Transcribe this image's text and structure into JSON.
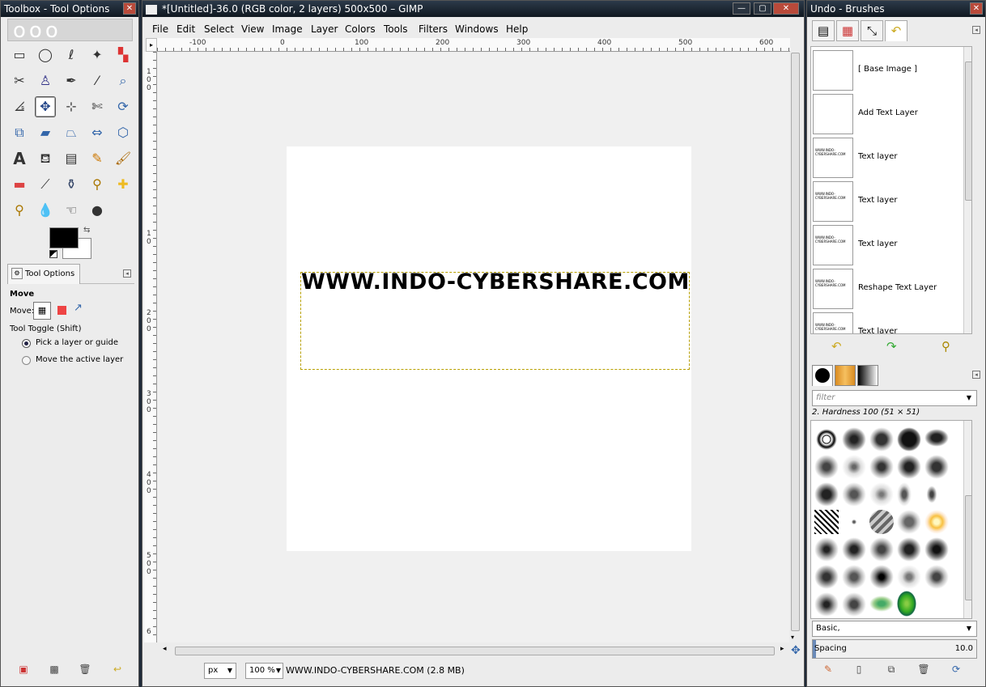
{
  "toolbox": {
    "title": "Toolbox - Tool Options",
    "fg_color": "#000000",
    "bg_color": "#ffffff",
    "tool_options_tab": "Tool Options",
    "tool_name": "Move",
    "move_label": "Move:",
    "tool_toggle": "Tool Toggle  (Shift)",
    "radio_pick": "Pick a layer or guide",
    "radio_move_active": "Move the active layer",
    "tools": [
      "rect-select-icon",
      "ellipse-select-icon",
      "free-select-icon",
      "fuzzy-select-icon",
      "color-select-icon",
      "scissors-icon",
      "foreground-select-icon",
      "paths-icon",
      "color-picker-icon",
      "zoom-icon",
      "measure-icon",
      "move-icon",
      "align-icon",
      "crop-icon",
      "rotate-icon",
      "scale-icon",
      "shear-icon",
      "perspective-icon",
      "flip-icon",
      "cage-icon",
      "text-icon",
      "bucket-fill-icon",
      "blend-icon",
      "pencil-icon",
      "paintbrush-icon",
      "eraser-icon",
      "airbrush-icon",
      "ink-icon",
      "clone-icon",
      "heal-icon",
      "perspective-clone-icon",
      "blur-icon",
      "smudge-icon",
      "dodge-burn-icon"
    ]
  },
  "main": {
    "title": "*[Untitled]-36.0 (RGB color, 2 layers) 500x500 – GIMP",
    "menu": [
      "File",
      "Edit",
      "Select",
      "View",
      "Image",
      "Layer",
      "Colors",
      "Tools",
      "Filters",
      "Windows",
      "Help"
    ],
    "ruler_h": [
      "-100",
      "0",
      "100",
      "200",
      "300",
      "400",
      "500",
      "600"
    ],
    "ruler_v": [
      "1",
      "0",
      "1",
      "0",
      "2",
      "0",
      "0",
      "3",
      "0",
      "0",
      "4",
      "0",
      "0",
      "5",
      "0",
      "0",
      "6",
      "0"
    ],
    "canvas_text": "WWW.INDO-CYBERSHARE.COM",
    "unit": "px",
    "zoom": "100 %",
    "status": "WWW.INDO-CYBERSHARE.COM (2.8 MB)"
  },
  "dock": {
    "title": "Undo - Brushes",
    "undo_items": [
      {
        "label": "[ Base Image ]",
        "thumb": ""
      },
      {
        "label": "Add Text Layer",
        "thumb": ""
      },
      {
        "label": "Text layer",
        "thumb": "WWW.INDO-CYBERSHARE.COM"
      },
      {
        "label": "Text layer",
        "thumb": "WWW.INDO-CYBERSHARE.COM"
      },
      {
        "label": "Text layer",
        "thumb": "WWW.INDO-CYBERSHARE.COM"
      },
      {
        "label": "Reshape Text Layer",
        "thumb": "WWW.INDO-CYBERSHARE.COM"
      },
      {
        "label": "Text layer",
        "thumb": "WWW.INDO-CYBERSHARE.COM"
      }
    ],
    "brush_filter_placeholder": "filter",
    "brush_name": "2. Hardness 100 (51 × 51)",
    "brush_tag": "Basic,",
    "spacing_label": "Spacing",
    "spacing_value": "10.0"
  }
}
